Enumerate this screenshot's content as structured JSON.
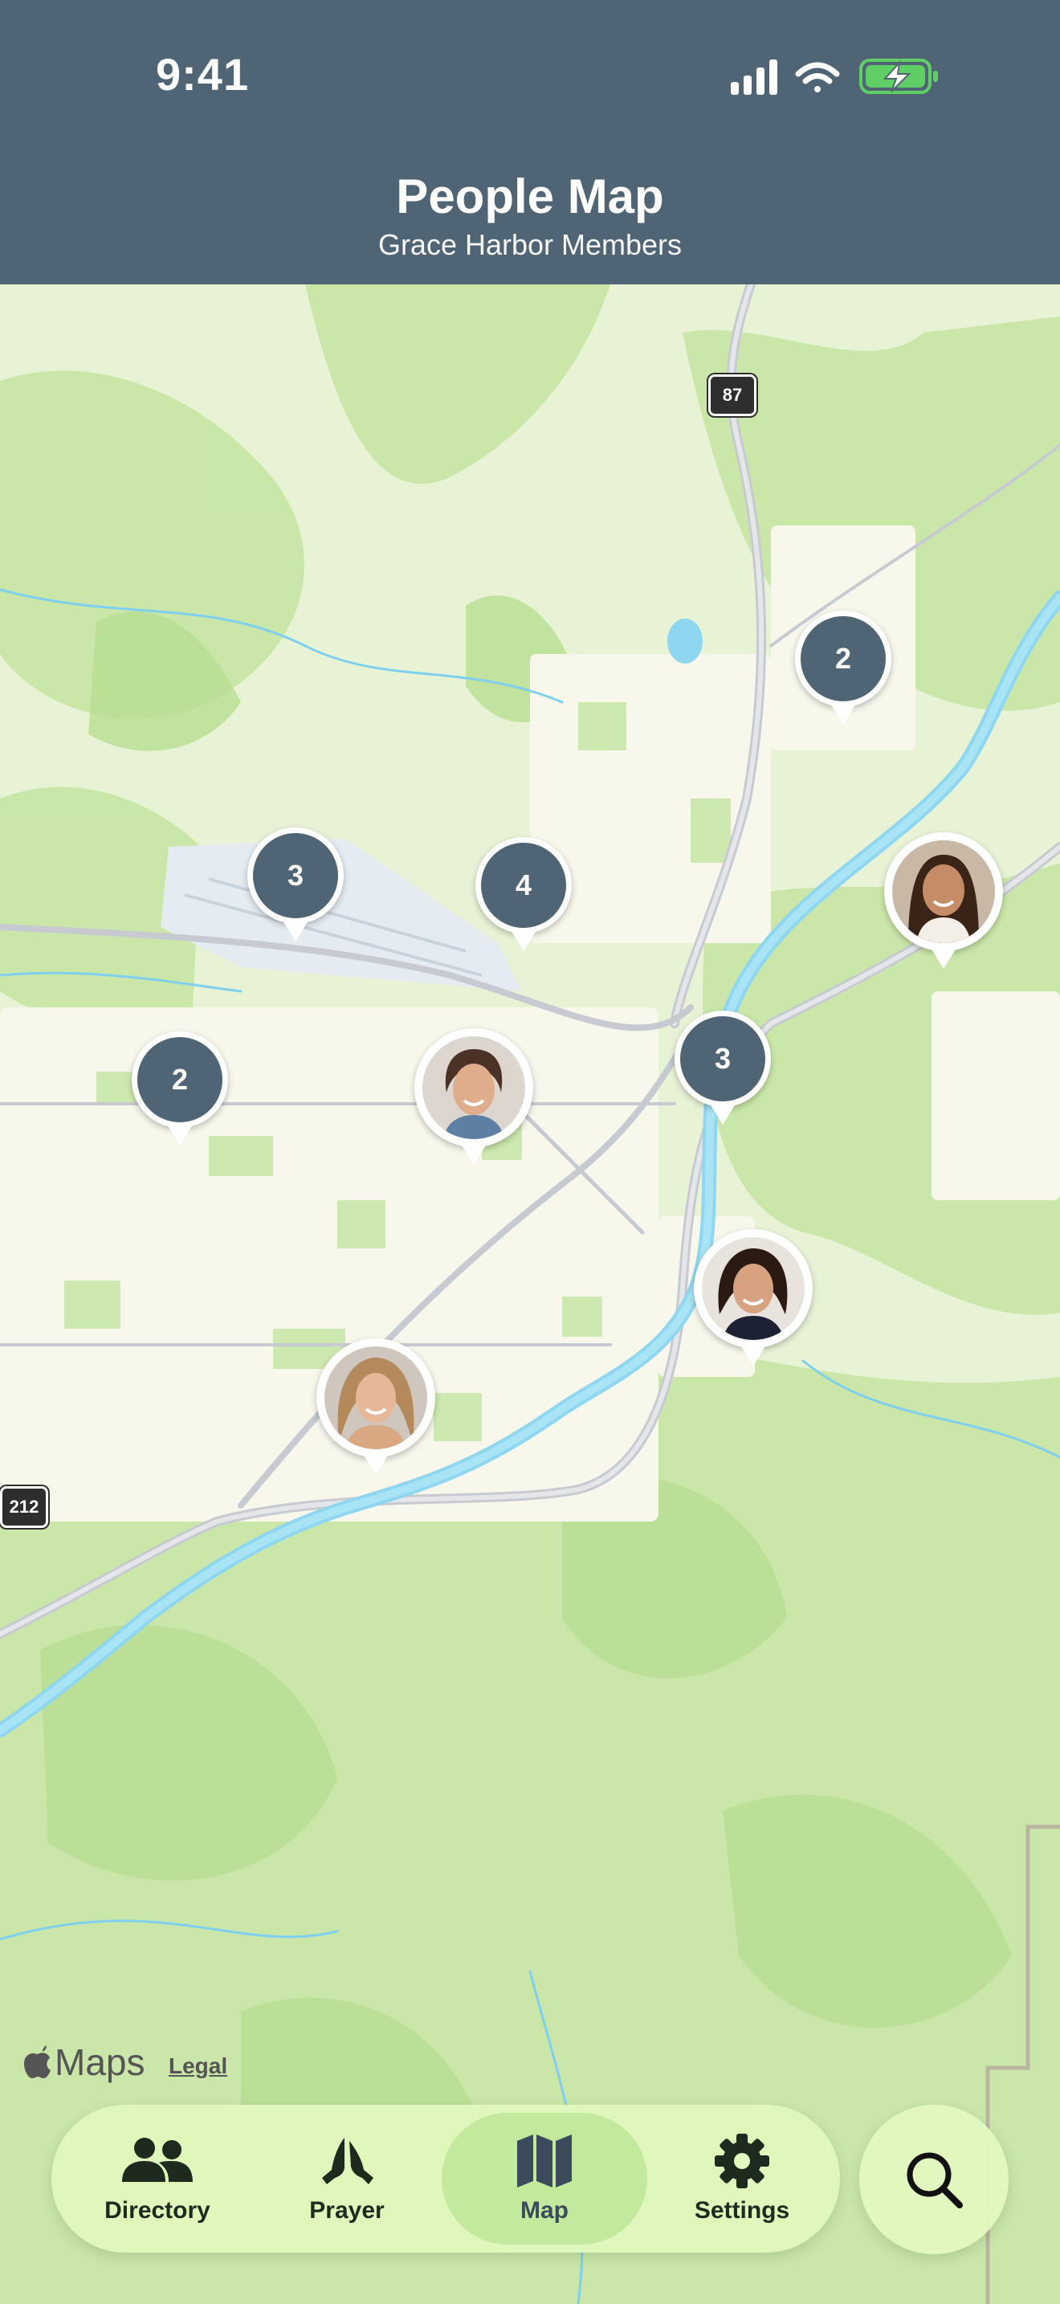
{
  "status_bar": {
    "time": "9:41"
  },
  "header": {
    "title": "People Map",
    "subtitle": "Grace Harbor Members"
  },
  "map": {
    "clusters": [
      {
        "count": "2"
      },
      {
        "count": "3"
      },
      {
        "count": "4"
      },
      {
        "count": "2"
      },
      {
        "count": "3"
      }
    ],
    "member_avatars": [
      "member-1",
      "member-2",
      "member-3",
      "member-4"
    ],
    "route_shields": [
      "87",
      "212"
    ],
    "attribution": {
      "logo": "Maps",
      "legal": "Legal"
    }
  },
  "tabs": [
    {
      "label": "Directory",
      "icon": "people-icon"
    },
    {
      "label": "Prayer",
      "icon": "praying-hands-icon"
    },
    {
      "label": "Map",
      "icon": "map-icon",
      "active": true
    },
    {
      "label": "Settings",
      "icon": "gear-icon"
    }
  ],
  "search": {
    "icon": "search-icon"
  },
  "colors": {
    "header": "#4f6474",
    "accent": "#4f6474",
    "tabbar": "#e2f8be"
  }
}
